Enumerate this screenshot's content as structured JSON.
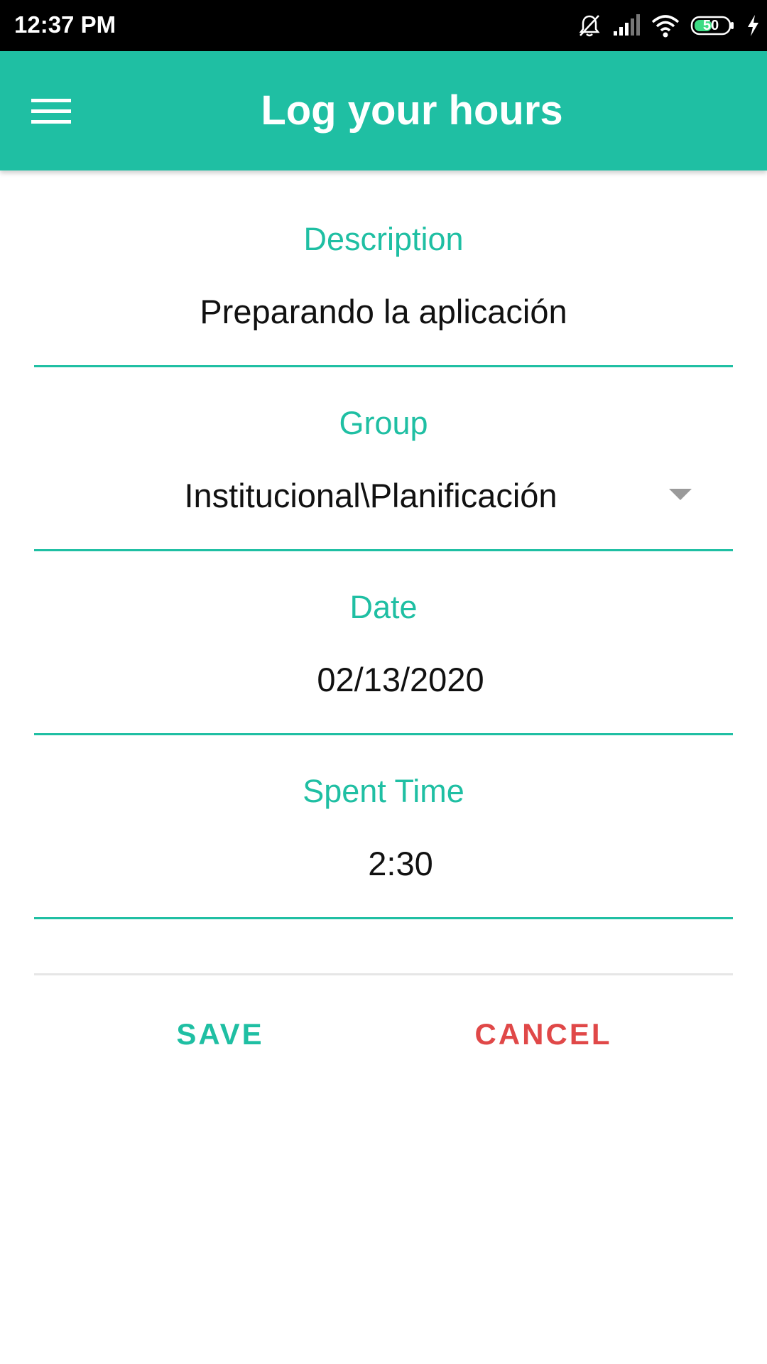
{
  "status_bar": {
    "time": "12:37 PM",
    "battery_level": "50",
    "icons": [
      "bell-off-icon",
      "signal-icon",
      "wifi-icon",
      "battery-icon",
      "charging-bolt-icon"
    ]
  },
  "app_bar": {
    "title": "Log your hours",
    "menu_icon": "hamburger-menu-icon",
    "color": "#1fbfa3"
  },
  "form": {
    "description": {
      "label": "Description",
      "value": "Preparando la aplicación"
    },
    "group": {
      "label": "Group",
      "value": "Institucional\\Planificación"
    },
    "date": {
      "label": "Date",
      "value": "02/13/2020"
    },
    "spent_time": {
      "label": "Spent Time",
      "value": "2:30"
    }
  },
  "actions": {
    "save_label": "SAVE",
    "cancel_label": "CANCEL",
    "save_color": "#1fbfa3",
    "cancel_color": "#e04848"
  }
}
